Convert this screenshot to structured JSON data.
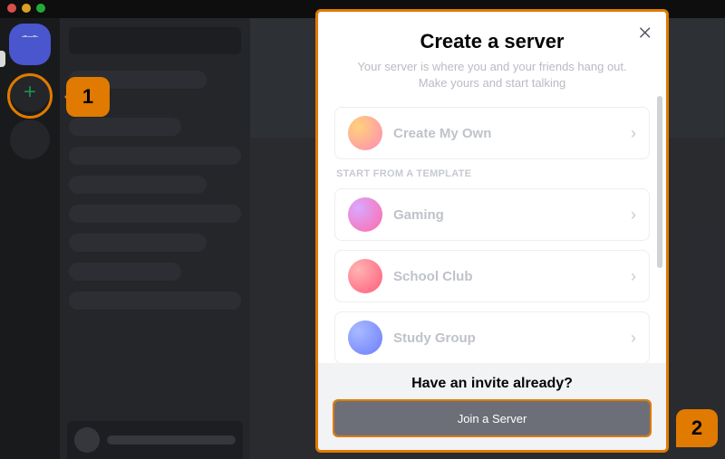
{
  "annotations": {
    "step1": "1",
    "step2": "2"
  },
  "modal": {
    "title": "Create a server",
    "subtitle": "Your server is where you and your friends hang out. Make yours and start talking",
    "close_icon": "×",
    "own": {
      "label": "Create My Own"
    },
    "template_header": "START FROM A TEMPLATE",
    "templates": [
      {
        "label": "Gaming"
      },
      {
        "label": "School Club"
      },
      {
        "label": "Study Group"
      }
    ],
    "footer": {
      "title": "Have an invite already?",
      "join_label": "Join a Server"
    }
  }
}
